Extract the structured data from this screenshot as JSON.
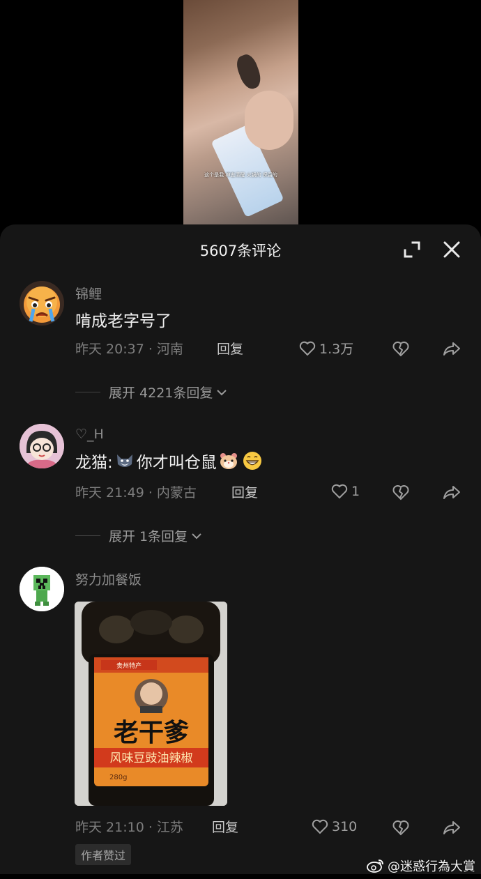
{
  "video": {
    "caption": "这个是我 神志清醒 火锅的 保留的"
  },
  "sheet": {
    "title": "5607条评论"
  },
  "comments": [
    {
      "username": "锦鲤",
      "text": "啃成老字号了",
      "time_location": "昨天 20:37 · 河南",
      "reply_label": "回复",
      "likes": "1.3万",
      "expand_label": "展开 4221条回复",
      "avatar_icon": "angry-crying-face-icon"
    },
    {
      "username": "♡_H",
      "text_prefix": "龙猫:",
      "text_middle": "你才叫仓鼠",
      "time_location": "昨天 21:49 · 内蒙古",
      "reply_label": "回复",
      "likes": "1",
      "expand_label": "展开 1条回复",
      "avatar_icon": "cartoon-girl-icon"
    },
    {
      "username": "努力加餐饭",
      "time_location": "昨天 21:10 · 江苏",
      "reply_label": "回复",
      "likes": "310",
      "badge": "作者赞过",
      "avatar_icon": "creeper-icon",
      "photo": {
        "brand": "老干爹",
        "subtitle": "风味豆豉油辣椒",
        "top_label": "贵州特产",
        "weight": "280g"
      }
    }
  ],
  "watermark": "@迷惑行為大賞"
}
